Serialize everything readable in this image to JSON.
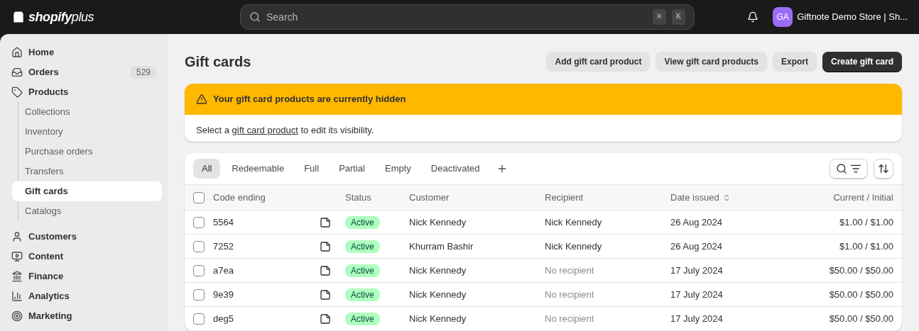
{
  "topbar": {
    "logo": {
      "brand": "shopify",
      "tier": "plus"
    },
    "search": {
      "placeholder": "Search",
      "shortcut_keys": [
        "⌘",
        "K"
      ]
    },
    "store": {
      "initials": "GA",
      "name": "Giftnote Demo Store | Sh..."
    }
  },
  "sidebar": {
    "items": [
      {
        "label": "Home",
        "selected": false
      },
      {
        "label": "Orders",
        "selected": false,
        "badge": "529"
      },
      {
        "label": "Products",
        "selected": false,
        "expanded": true,
        "children": [
          {
            "label": "Collections",
            "selected": false
          },
          {
            "label": "Inventory",
            "selected": false
          },
          {
            "label": "Purchase orders",
            "selected": false
          },
          {
            "label": "Transfers",
            "selected": false
          },
          {
            "label": "Gift cards",
            "selected": true
          },
          {
            "label": "Catalogs",
            "selected": false
          }
        ]
      },
      {
        "label": "Customers",
        "selected": false
      },
      {
        "label": "Content",
        "selected": false
      },
      {
        "label": "Finance",
        "selected": false
      },
      {
        "label": "Analytics",
        "selected": false
      },
      {
        "label": "Marketing",
        "selected": false
      }
    ]
  },
  "page": {
    "title": "Gift cards",
    "actions": [
      {
        "label": "Add gift card product",
        "primary": false
      },
      {
        "label": "View gift card products",
        "primary": false
      },
      {
        "label": "Export",
        "primary": false
      },
      {
        "label": "Create gift card",
        "primary": true
      }
    ]
  },
  "banner": {
    "title": "Your gift card products are currently hidden",
    "text_before": "Select a",
    "link": "gift card product",
    "text_after": "to edit its visibility."
  },
  "table": {
    "tabs": [
      {
        "label": "All",
        "selected": true
      },
      {
        "label": "Redeemable",
        "selected": false
      },
      {
        "label": "Full",
        "selected": false
      },
      {
        "label": "Partial",
        "selected": false
      },
      {
        "label": "Empty",
        "selected": false
      },
      {
        "label": "Deactivated",
        "selected": false
      }
    ],
    "select_all_checked": false,
    "columns": [
      "Code ending",
      "Status",
      "Customer",
      "Recipient",
      "Date issued",
      "Current / Initial"
    ],
    "rows": [
      {
        "code": "5564",
        "checked": false,
        "status": "Active",
        "customer": "Nick Kennedy",
        "recipient": "Nick Kennedy",
        "recipient_muted": false,
        "date": "26 Aug 2024",
        "balance": "$1.00 / $1.00"
      },
      {
        "code": "7252",
        "checked": false,
        "status": "Active",
        "customer": "Khurram Bashir",
        "recipient": "Nick Kennedy",
        "recipient_muted": false,
        "date": "26 Aug 2024",
        "balance": "$1.00 / $1.00"
      },
      {
        "code": "a7ea",
        "checked": false,
        "status": "Active",
        "customer": "Nick Kennedy",
        "recipient": "No recipient",
        "recipient_muted": true,
        "date": "17 July 2024",
        "balance": "$50.00 / $50.00"
      },
      {
        "code": "9e39",
        "checked": false,
        "status": "Active",
        "customer": "Nick Kennedy",
        "recipient": "No recipient",
        "recipient_muted": true,
        "date": "17 July 2024",
        "balance": "$50.00 / $50.00"
      },
      {
        "code": "deg5",
        "checked": false,
        "status": "Active",
        "customer": "Nick Kennedy",
        "recipient": "No recipient",
        "recipient_muted": true,
        "date": "17 July 2024",
        "balance": "$50.00 / $50.00"
      }
    ]
  }
}
